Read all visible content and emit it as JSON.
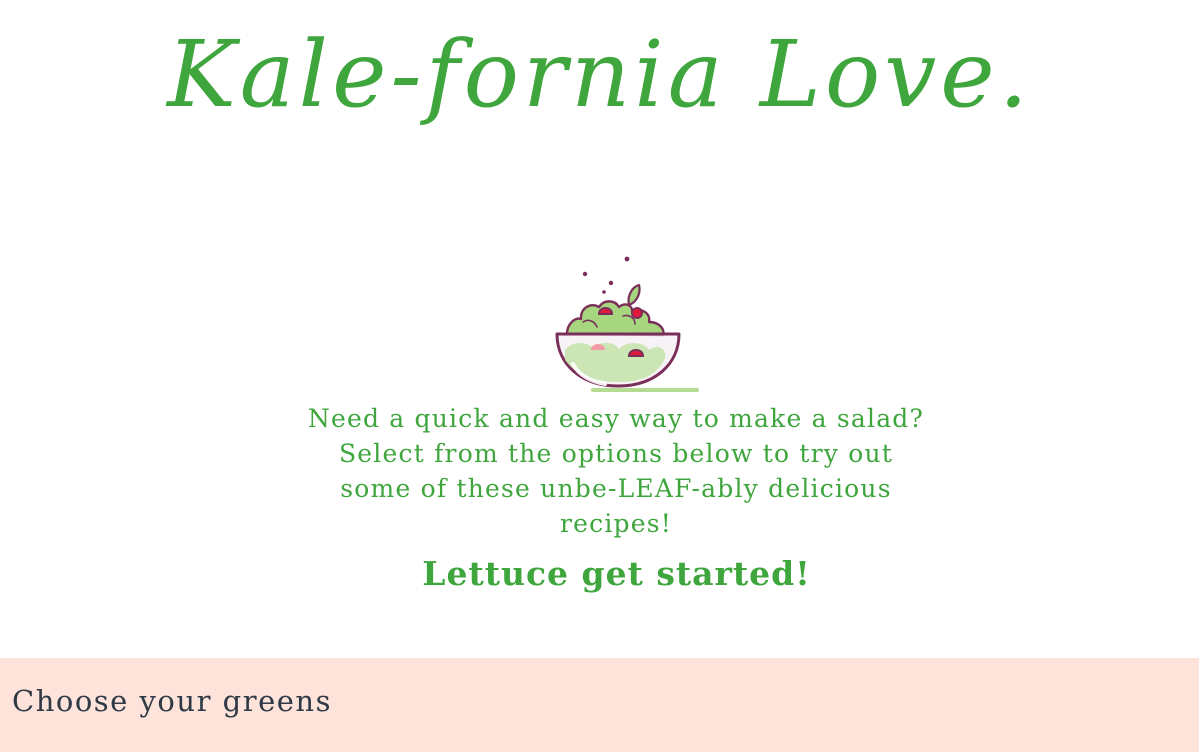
{
  "header": {
    "title": "Kale-fornia Love."
  },
  "hero": {
    "icon": "salad-bowl-icon",
    "intro_text": "Need a quick and easy way to make a salad? Select from the options below to try out some of these unbe-LEAF-ably delicious recipes!",
    "cta_text": "Lettuce get started!"
  },
  "greens_section": {
    "heading": "Choose your greens"
  },
  "colors": {
    "brand_green": "#3ea63d",
    "greens_band": "#fde3da",
    "heading_text": "#2f3a46",
    "bowl_outline": "#7a2f5a",
    "tomato_red": "#e0193a"
  }
}
